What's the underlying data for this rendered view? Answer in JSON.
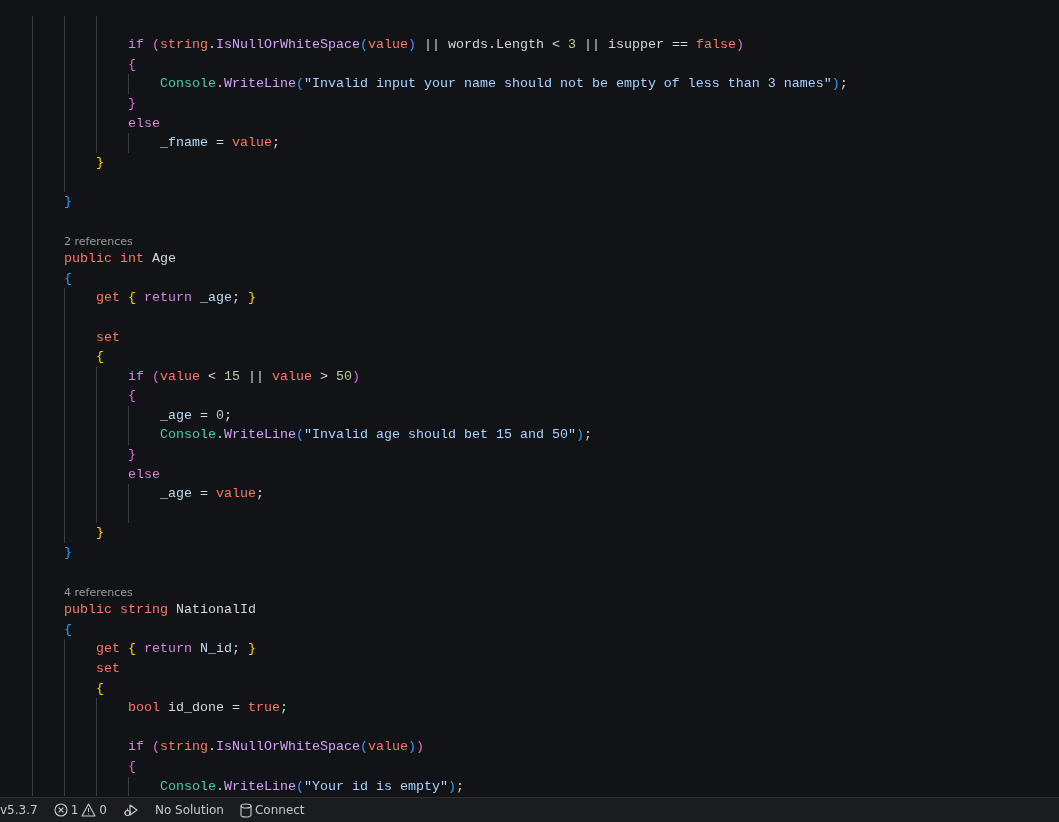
{
  "editor": {
    "lines": [
      {
        "kind": "blank"
      },
      {
        "kind": "code",
        "tokens": [
          {
            "kind": "ctl",
            "text": "                if "
          },
          {
            "kind": "b2",
            "text": "("
          },
          {
            "kind": "kw",
            "text": "string"
          },
          {
            "kind": "id",
            "text": "."
          },
          {
            "kind": "mth",
            "text": "IsNullOrWhiteSpace"
          },
          {
            "kind": "b3",
            "text": "("
          },
          {
            "kind": "kw",
            "text": "value"
          },
          {
            "kind": "b3",
            "text": ")"
          },
          {
            "kind": "id",
            "text": " || words.Length < "
          },
          {
            "kind": "num",
            "text": "3"
          },
          {
            "kind": "id",
            "text": " || isupper == "
          },
          {
            "kind": "kw",
            "text": "false"
          },
          {
            "kind": "b2",
            "text": ")"
          }
        ]
      },
      {
        "kind": "code",
        "tokens": [
          {
            "kind": "b2",
            "text": "                {"
          }
        ]
      },
      {
        "kind": "code",
        "tokens": [
          {
            "kind": "typ",
            "text": "                    Console"
          },
          {
            "kind": "id",
            "text": "."
          },
          {
            "kind": "mth",
            "text": "WriteLine"
          },
          {
            "kind": "b3",
            "text": "("
          },
          {
            "kind": "str",
            "text": "\"Invalid input your name should not be empty of less than 3 names\""
          },
          {
            "kind": "b3",
            "text": ")"
          },
          {
            "kind": "id",
            "text": ";"
          }
        ]
      },
      {
        "kind": "code",
        "tokens": [
          {
            "kind": "b2",
            "text": "                }"
          }
        ]
      },
      {
        "kind": "code",
        "tokens": [
          {
            "kind": "ctl",
            "text": "                else"
          }
        ]
      },
      {
        "kind": "code",
        "tokens": [
          {
            "kind": "fld",
            "text": "                    _fname"
          },
          {
            "kind": "id",
            "text": " = "
          },
          {
            "kind": "kw",
            "text": "value"
          },
          {
            "kind": "id",
            "text": ";"
          }
        ]
      },
      {
        "kind": "code",
        "tokens": [
          {
            "kind": "b1",
            "text": "            }"
          }
        ]
      },
      {
        "kind": "blank"
      },
      {
        "kind": "code",
        "tokens": [
          {
            "kind": "b3",
            "text": "        }"
          }
        ]
      },
      {
        "kind": "blank"
      },
      {
        "kind": "codelens",
        "text": "2 references"
      },
      {
        "kind": "code",
        "tokens": [
          {
            "kind": "kw",
            "text": "        public int "
          },
          {
            "kind": "id",
            "text": "Age"
          }
        ]
      },
      {
        "kind": "code",
        "tokens": [
          {
            "kind": "b3",
            "text": "        {"
          }
        ]
      },
      {
        "kind": "code",
        "tokens": [
          {
            "kind": "kw",
            "text": "            get "
          },
          {
            "kind": "b1",
            "text": "{"
          },
          {
            "kind": "ctl",
            "text": " return "
          },
          {
            "kind": "fld",
            "text": "_age"
          },
          {
            "kind": "id",
            "text": "; "
          },
          {
            "kind": "b1",
            "text": "}"
          }
        ]
      },
      {
        "kind": "blank"
      },
      {
        "kind": "code",
        "tokens": [
          {
            "kind": "kw",
            "text": "            set"
          }
        ]
      },
      {
        "kind": "code",
        "tokens": [
          {
            "kind": "b1",
            "text": "            {"
          }
        ]
      },
      {
        "kind": "code",
        "tokens": [
          {
            "kind": "ctl",
            "text": "                if "
          },
          {
            "kind": "b2",
            "text": "("
          },
          {
            "kind": "kw",
            "text": "value"
          },
          {
            "kind": "id",
            "text": " < "
          },
          {
            "kind": "num",
            "text": "15"
          },
          {
            "kind": "id",
            "text": " || "
          },
          {
            "kind": "kw",
            "text": "value"
          },
          {
            "kind": "id",
            "text": " > "
          },
          {
            "kind": "num",
            "text": "50"
          },
          {
            "kind": "b2",
            "text": ")"
          }
        ]
      },
      {
        "kind": "code",
        "tokens": [
          {
            "kind": "b2",
            "text": "                {"
          }
        ]
      },
      {
        "kind": "code",
        "tokens": [
          {
            "kind": "fld",
            "text": "                    _age"
          },
          {
            "kind": "id",
            "text": " = "
          },
          {
            "kind": "num",
            "text": "0"
          },
          {
            "kind": "id",
            "text": ";"
          }
        ]
      },
      {
        "kind": "code",
        "tokens": [
          {
            "kind": "typ",
            "text": "                    Console"
          },
          {
            "kind": "id",
            "text": "."
          },
          {
            "kind": "mth",
            "text": "WriteLine"
          },
          {
            "kind": "b3",
            "text": "("
          },
          {
            "kind": "str",
            "text": "\"Invalid age should bet 15 and 50\""
          },
          {
            "kind": "b3",
            "text": ")"
          },
          {
            "kind": "id",
            "text": ";"
          }
        ]
      },
      {
        "kind": "code",
        "tokens": [
          {
            "kind": "b2",
            "text": "                }"
          }
        ]
      },
      {
        "kind": "code",
        "tokens": [
          {
            "kind": "ctl",
            "text": "                else"
          }
        ]
      },
      {
        "kind": "code",
        "tokens": [
          {
            "kind": "fld",
            "text": "                    _age"
          },
          {
            "kind": "id",
            "text": " = "
          },
          {
            "kind": "kw",
            "text": "value"
          },
          {
            "kind": "id",
            "text": ";"
          }
        ]
      },
      {
        "kind": "blank"
      },
      {
        "kind": "code",
        "tokens": [
          {
            "kind": "b1",
            "text": "            }"
          }
        ]
      },
      {
        "kind": "code",
        "tokens": [
          {
            "kind": "b3",
            "text": "        }"
          }
        ]
      },
      {
        "kind": "blank"
      },
      {
        "kind": "codelens",
        "text": "4 references"
      },
      {
        "kind": "code",
        "tokens": [
          {
            "kind": "kw",
            "text": "        public string "
          },
          {
            "kind": "id",
            "text": "NationalId"
          }
        ]
      },
      {
        "kind": "code",
        "tokens": [
          {
            "kind": "b3",
            "text": "        {"
          }
        ]
      },
      {
        "kind": "code",
        "tokens": [
          {
            "kind": "kw",
            "text": "            get "
          },
          {
            "kind": "b1",
            "text": "{"
          },
          {
            "kind": "ctl",
            "text": " return "
          },
          {
            "kind": "fld",
            "text": "N_id"
          },
          {
            "kind": "id",
            "text": "; "
          },
          {
            "kind": "b1",
            "text": "}"
          }
        ]
      },
      {
        "kind": "code",
        "tokens": [
          {
            "kind": "kw",
            "text": "            set"
          }
        ]
      },
      {
        "kind": "code",
        "tokens": [
          {
            "kind": "b1",
            "text": "            {"
          }
        ]
      },
      {
        "kind": "code",
        "tokens": [
          {
            "kind": "kw",
            "text": "                bool "
          },
          {
            "kind": "id",
            "text": "id_done = "
          },
          {
            "kind": "kw",
            "text": "true"
          },
          {
            "kind": "id",
            "text": ";"
          }
        ]
      },
      {
        "kind": "blank"
      },
      {
        "kind": "code",
        "tokens": [
          {
            "kind": "ctl",
            "text": "                if "
          },
          {
            "kind": "b2",
            "text": "("
          },
          {
            "kind": "kw",
            "text": "string"
          },
          {
            "kind": "id",
            "text": "."
          },
          {
            "kind": "mth",
            "text": "IsNullOrWhiteSpace"
          },
          {
            "kind": "b3",
            "text": "("
          },
          {
            "kind": "kw",
            "text": "value"
          },
          {
            "kind": "b3",
            "text": ")"
          },
          {
            "kind": "b2",
            "text": ")"
          }
        ]
      },
      {
        "kind": "code",
        "tokens": [
          {
            "kind": "b2",
            "text": "                {"
          }
        ]
      },
      {
        "kind": "code",
        "tokens": [
          {
            "kind": "typ",
            "text": "                    Console"
          },
          {
            "kind": "id",
            "text": "."
          },
          {
            "kind": "mth",
            "text": "WriteLine"
          },
          {
            "kind": "b3",
            "text": "("
          },
          {
            "kind": "str",
            "text": "\"Your id is empty\""
          },
          {
            "kind": "b3",
            "text": ")"
          },
          {
            "kind": "id",
            "text": ";"
          }
        ]
      }
    ]
  },
  "status_bar": {
    "version": "v5.3.7",
    "errors": "1",
    "warnings": "0",
    "solution": "No Solution",
    "connect": "Connect"
  }
}
